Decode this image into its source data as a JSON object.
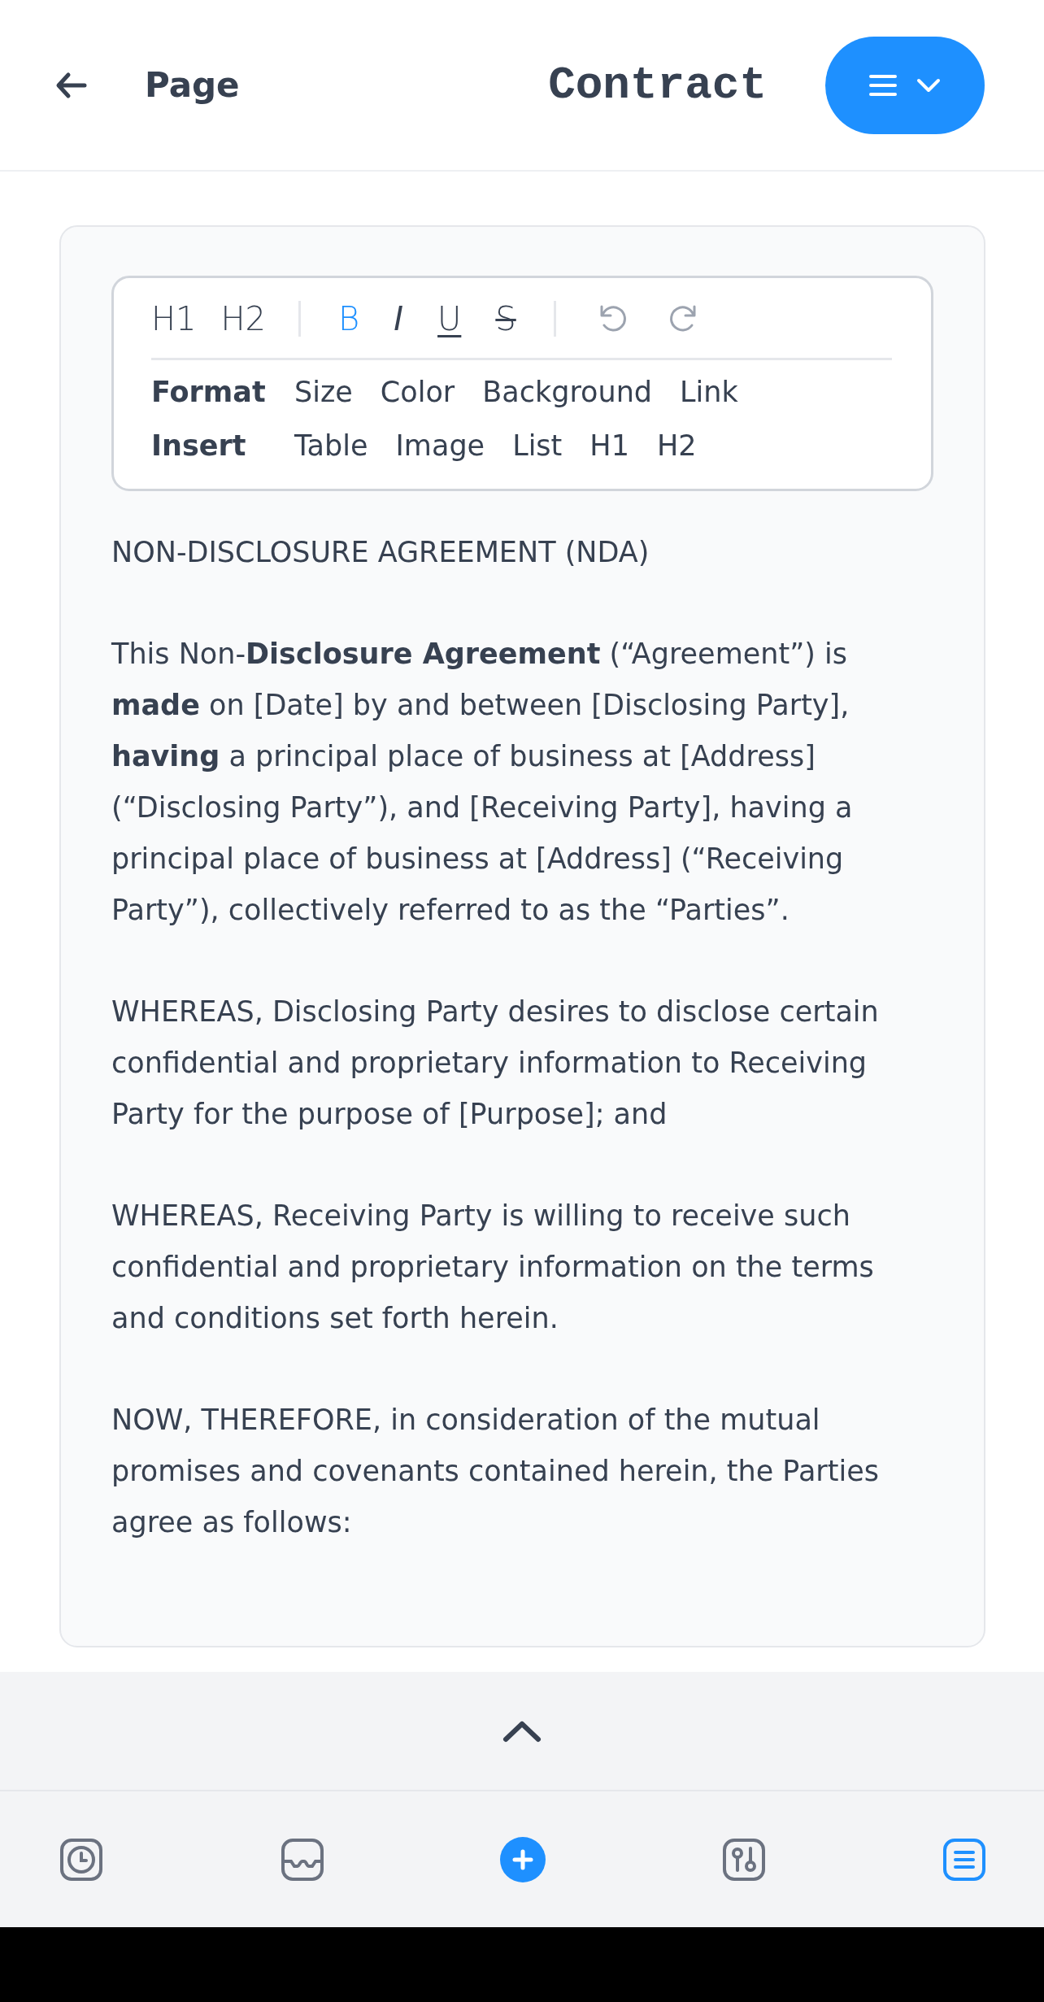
{
  "header": {
    "back_label": "Page",
    "title": "Contract"
  },
  "toolbar": {
    "headings": [
      "H1",
      "H2"
    ],
    "formats": [
      {
        "kind": "bold",
        "label": "B",
        "active": true
      },
      {
        "kind": "italic",
        "label": "I",
        "active": false
      },
      {
        "kind": "underline",
        "label": "U",
        "active": false
      },
      {
        "kind": "strike",
        "label": "S",
        "active": false
      }
    ],
    "history": [
      {
        "kind": "undo",
        "disabled": true
      },
      {
        "kind": "redo",
        "disabled": true
      }
    ],
    "menus": [
      {
        "label": "Format",
        "items": [
          "Size",
          "Color",
          "Background",
          "Link"
        ]
      },
      {
        "label": "Insert",
        "items": [
          "Table",
          "Image",
          "List",
          "H1",
          "H2"
        ]
      }
    ]
  },
  "document": {
    "title": "NON-DISCLOSURE AGREEMENT (NDA)",
    "paragraphs": [
      "This Non-**Disclosure Agreement** (“Agreement”) is **made** on [Date] by and between [Disclosing Party], **having** a principal place of business at [Address] (“Disclosing Party”), and [Receiving Party], having a principal place of business at [Address] (“Receiving Party”), collectively referred to as the “Parties”.",
      "WHEREAS, Disclosing Party desires to disclose certain confidential and proprietary information to Receiving Party for the purpose of [Purpose]; and",
      "WHEREAS, Receiving Party is willing to receive such confidential and proprietary information on the terms and conditions set forth herein.",
      "NOW, THEREFORE, in consideration of the mutual promises and covenants contained herein, the Parties agree as follows:"
    ]
  },
  "nav": [
    {
      "kind": "clock",
      "selected": false
    },
    {
      "kind": "inbox",
      "selected": false
    },
    {
      "kind": "add",
      "selected": false
    },
    {
      "kind": "sliders",
      "selected": false
    },
    {
      "kind": "list",
      "selected": true
    }
  ]
}
